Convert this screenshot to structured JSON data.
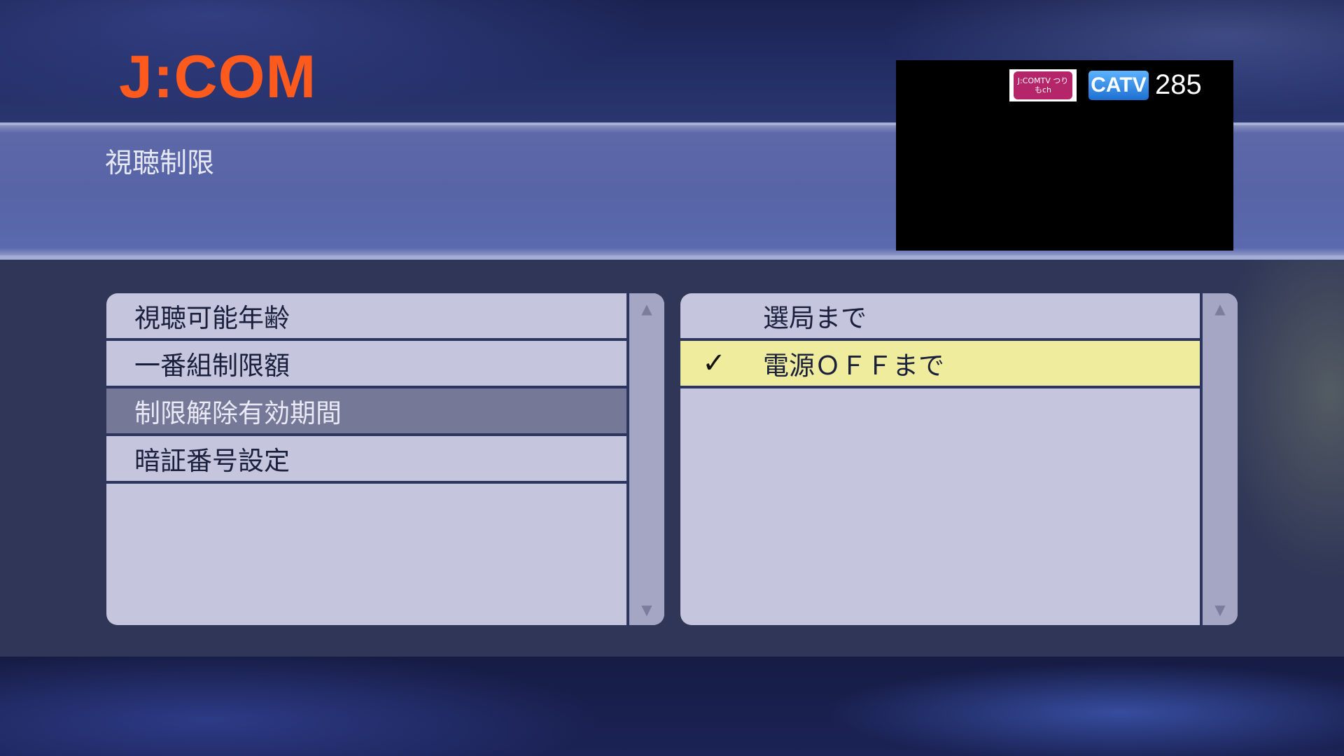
{
  "header": {
    "logo_text": "J:COM",
    "page_title": "視聴制限"
  },
  "preview": {
    "channel_logo_text": "J:COMTV つりもch",
    "badge": "CATV",
    "channel_number": "285"
  },
  "left_menu": {
    "items": [
      {
        "label": "視聴可能年齢"
      },
      {
        "label": "一番組制限額"
      },
      {
        "label": "制限解除有効期間"
      },
      {
        "label": "暗証番号設定"
      }
    ],
    "selected_index": 2
  },
  "right_options": {
    "items": [
      {
        "label": "選局まで",
        "checked": false
      },
      {
        "label": "電源ＯＦＦまで",
        "checked": true
      }
    ],
    "check_mark": "✓"
  },
  "scroll": {
    "up_arrow": "▲",
    "down_arrow": "▼"
  },
  "colors": {
    "logo": "#ff5a1e",
    "selection": "#767898",
    "checked_highlight": "#f0ec9e",
    "catv_badge": "#1e6fd0"
  }
}
